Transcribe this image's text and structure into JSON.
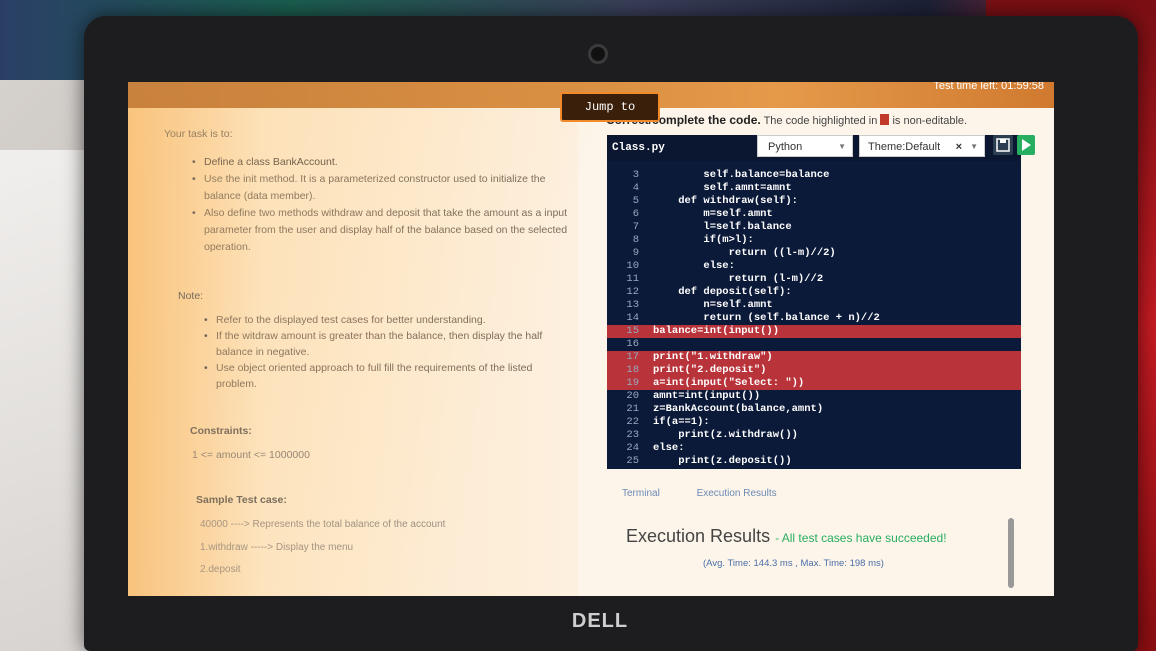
{
  "header": {
    "jump_label": "Jump to",
    "test_time": "Test time left: 01:59:58"
  },
  "problem": {
    "task_intro": "Your task is to:",
    "description": [
      "Define a class BankAccount.",
      "Use the init method. It is a parameterized constructor used to initialize the balance (data member).",
      "Also define two methods withdraw and deposit that take the amount as a input parameter from the user and display half of the balance based on the selected operation."
    ],
    "note_label": "Note:",
    "notes": [
      "Refer to the displayed test cases for better understanding.",
      "If the witdraw amount is greater than the balance, then display the half balance in negative.",
      "Use object oriented approach to full fill the requirements of the listed problem."
    ],
    "constraints_label": "Constraints:",
    "constraints_value": "1 <= amount <= 1000000",
    "sample_label": "Sample Test case:",
    "sample_lines": [
      "40000 ----> Represents the total balance of the account",
      "1.withdraw -----> Display the menu",
      "2.deposit"
    ]
  },
  "editor": {
    "instruction": "Correct/complete the code.",
    "instruction_suffix": "The code highlighted in",
    "instruction_end": "is non-editable.",
    "filename": "Class.py",
    "language": "Python",
    "theme": "Theme:Default",
    "lines": [
      {
        "n": "3",
        "text": "        self.balance=balance",
        "hl": false
      },
      {
        "n": "4",
        "text": "        self.amnt=amnt",
        "hl": false
      },
      {
        "n": "5",
        "text": "    def withdraw(self):",
        "hl": false
      },
      {
        "n": "6",
        "text": "        m=self.amnt",
        "hl": false
      },
      {
        "n": "7",
        "text": "        l=self.balance",
        "hl": false
      },
      {
        "n": "8",
        "text": "        if(m>l):",
        "hl": false
      },
      {
        "n": "9",
        "text": "            return ((l-m)//2)",
        "hl": false
      },
      {
        "n": "10",
        "text": "        else:",
        "hl": false
      },
      {
        "n": "11",
        "text": "            return (l-m)//2",
        "hl": false
      },
      {
        "n": "12",
        "text": "    def deposit(self):",
        "hl": false
      },
      {
        "n": "13",
        "text": "        n=self.amnt",
        "hl": false
      },
      {
        "n": "14",
        "text": "        return (self.balance + n)//2",
        "hl": false
      },
      {
        "n": "15",
        "text": "balance=int(input())",
        "hl": true
      },
      {
        "n": "16",
        "text": "",
        "hl": false
      },
      {
        "n": "17",
        "text": "print(\"1.withdraw\")",
        "hl": true
      },
      {
        "n": "18",
        "text": "print(\"2.deposit\")",
        "hl": true
      },
      {
        "n": "19",
        "text": "a=int(input(\"Select: \"))",
        "hl": true
      },
      {
        "n": "20",
        "text": "amnt=int(input())",
        "hl": false
      },
      {
        "n": "21",
        "text": "z=BankAccount(balance,amnt)",
        "hl": false
      },
      {
        "n": "22",
        "text": "if(a==1):",
        "hl": false
      },
      {
        "n": "23",
        "text": "    print(z.withdraw())",
        "hl": false
      },
      {
        "n": "24",
        "text": "else:",
        "hl": false
      },
      {
        "n": "25",
        "text": "    print(z.deposit())",
        "hl": false
      }
    ]
  },
  "output": {
    "tab_terminal": "Terminal",
    "tab_results": "Execution Results",
    "title": "Execution Results",
    "status": "- All test cases have succeeded!",
    "timing": "(Avg. Time: 144.3 ms , Max. Time: 198 ms)"
  },
  "device": {
    "brand": "DELL"
  },
  "colors": {
    "accent_orange": "#e59a4a",
    "non_editable_red": "#b8333a",
    "editor_bg": "#0c1a3a",
    "success_green": "#27ae60"
  }
}
